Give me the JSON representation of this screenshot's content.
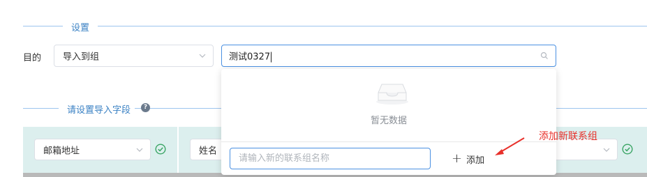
{
  "settings_section": {
    "title": "设置"
  },
  "target": {
    "label": "目的",
    "import_select_value": "导入到组",
    "group_search_value": "测试0327"
  },
  "dropdown": {
    "empty_text": "暂无数据",
    "new_group_placeholder": "请输入新的联系组名称",
    "add_button_label": "添加"
  },
  "fields_section": {
    "title": "请设置导入字段",
    "help_icon": "question-icon"
  },
  "field_columns": [
    {
      "select_value": "邮箱地址",
      "status_icon": "check-circle-icon"
    },
    {
      "select_value": "姓名",
      "status_icon": "check-circle-icon"
    }
  ],
  "annotation": {
    "text": "添加新联系组"
  },
  "colors": {
    "accent": "#4a90e2",
    "section_title": "#3b82c4",
    "field_column_bg": "#dcefee",
    "check_green": "#3aa564",
    "annotation_red": "#e8302a"
  }
}
